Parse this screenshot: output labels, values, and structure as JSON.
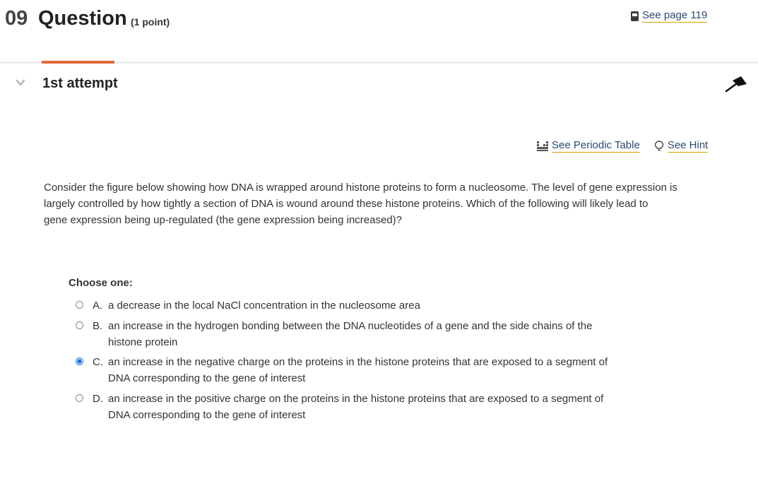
{
  "header": {
    "number": "09",
    "title": "Question",
    "points": "(1 point)",
    "see_page": "See page 119"
  },
  "attempt": {
    "label": "1st attempt"
  },
  "tools": {
    "periodic_table": "See Periodic Table",
    "hint": "See Hint"
  },
  "question": {
    "line1": "Consider the figure below showing how DNA is wrapped around histone proteins to form a nucleosome. The level of gene expression is",
    "line2": "largely controlled by how tightly a section of DNA is wound around these histone proteins. Which of the following will likely lead to",
    "line3": "gene expression being up-regulated (the gene expression being increased)?"
  },
  "choose_label": "Choose one:",
  "options": [
    {
      "letter": "A.",
      "line1": "a decrease in the local NaCl concentration in the nucleosome area",
      "line2": "",
      "selected": false
    },
    {
      "letter": "B.",
      "line1": "an increase in the hydrogen bonding between the DNA nucleotides of a gene and the side chains of the",
      "line2": "histone protein",
      "selected": false
    },
    {
      "letter": "C.",
      "line1": "an increase in the negative charge on the proteins in the histone proteins that are exposed to a segment of",
      "line2": "DNA corresponding to the gene of interest",
      "selected": true
    },
    {
      "letter": "D.",
      "line1": "an increase in the positive charge on the proteins in the histone proteins that are exposed to a segment of",
      "line2": "DNA corresponding to the gene of interest",
      "selected": false
    }
  ],
  "colors": {
    "accent": "#e26a3d",
    "link": "#2c4a73",
    "link_underline": "#d8a000",
    "radio_selected": "#1a73d9"
  }
}
